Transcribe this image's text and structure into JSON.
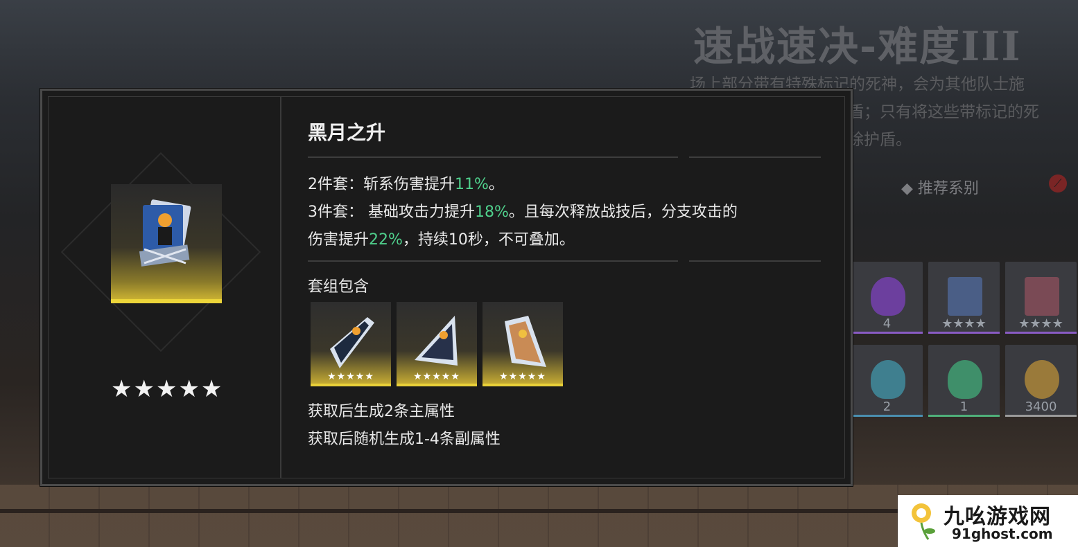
{
  "background": {
    "stage_title": "速战速决-难度III",
    "stage_desc_lines": [
      "场上部分带有特殊标记的死神，会为其他队士施",
      "盾；只有将这些带标记的死",
      "除护盾。"
    ],
    "recommend_label": "推荐系别",
    "rewards": [
      {
        "label": "4",
        "color": "#8a5bc4"
      },
      {
        "label": "★★★★",
        "color": "#8a5bc4"
      },
      {
        "label": "★★★★",
        "color": "#8a5bc4"
      },
      {
        "label": "2",
        "color": "#4a8fb0"
      },
      {
        "label": "1",
        "color": "#4fb07a"
      },
      {
        "label": "3400",
        "color": "#9a9a9a"
      }
    ]
  },
  "item": {
    "name": "黑月之升",
    "rarity_stars": "★★★★★",
    "set2_label": "2件套：",
    "set2_text": "斩系伤害提升",
    "set2_value": "11%",
    "set2_end": "。",
    "set3_label": "3件套：",
    "set3_text": "基础攻击力提升",
    "set3_value": "18%",
    "set3_text2": "。且每次释放战技后，分支攻击的",
    "set3_line2_text": "伤害提升",
    "set3_line2_value": "22%",
    "set3_line2_end": "，持续10秒，不可叠加。",
    "contains_label": "套组包含",
    "pieces": [
      {
        "stars": "★★★★★"
      },
      {
        "stars": "★★★★★"
      },
      {
        "stars": "★★★★★"
      }
    ],
    "note1": "获取后生成2条主属性",
    "note2": "获取后随机生成1-4条副属性"
  },
  "watermark": {
    "name": "九吆游戏网",
    "url": "91ghost.com"
  }
}
